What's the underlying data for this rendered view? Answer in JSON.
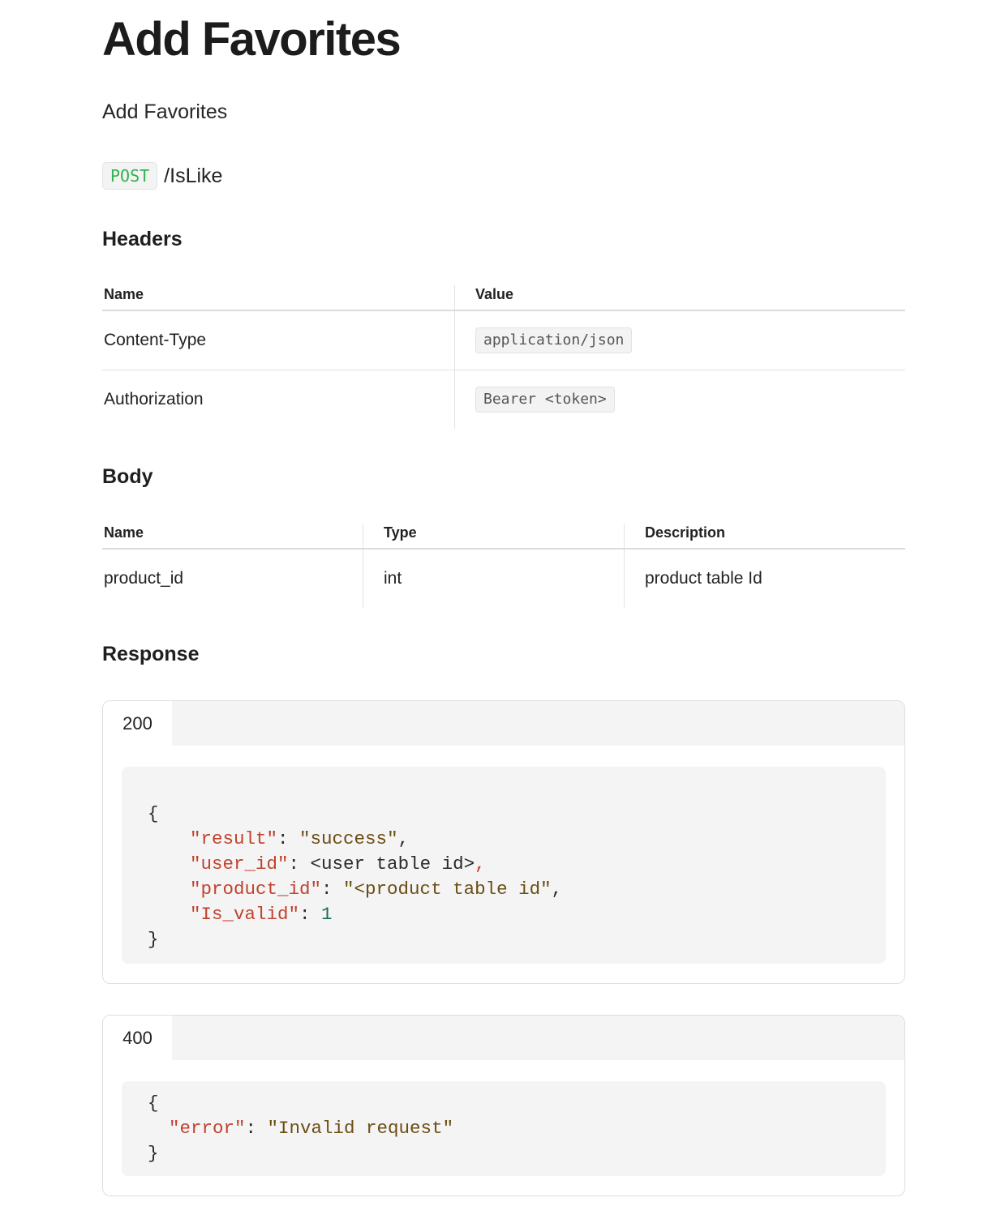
{
  "page": {
    "title": "Add Favorites",
    "description": "Add Favorites"
  },
  "endpoint": {
    "method": "POST",
    "path": "/IsLike",
    "method_color": "#2fb34f"
  },
  "headers": {
    "heading": "Headers",
    "columns": [
      "Name",
      "Value"
    ],
    "rows": [
      {
        "name": "Content-Type",
        "value": "application/json"
      },
      {
        "name": "Authorization",
        "value": "Bearer <token>"
      }
    ]
  },
  "body": {
    "heading": "Body",
    "columns": [
      "Name",
      "Type",
      "Description"
    ],
    "rows": [
      {
        "name": "product_id",
        "type": "int",
        "description": "product table Id"
      }
    ]
  },
  "response": {
    "heading": "Response",
    "blocks": [
      {
        "status": "200",
        "code": {
          "open": "{",
          "close": "}",
          "lines": [
            {
              "key": "\"result\"",
              "colon": ": ",
              "value": "\"success\"",
              "trail": ","
            },
            {
              "key": "\"user_id\"",
              "colon": ": ",
              "value": "<user table id>",
              "trail": ","
            },
            {
              "key": "\"product_id\"",
              "colon": ": ",
              "value": "\"<product table id\"",
              "trail": ","
            },
            {
              "key": "\"Is_valid\"",
              "colon": ": ",
              "value": "1",
              "trail": ""
            }
          ]
        }
      },
      {
        "status": "400",
        "code": {
          "open": "{",
          "close": "}",
          "lines": [
            {
              "key": "\"error\"",
              "colon": ": ",
              "value": "\"Invalid request\"",
              "trail": ""
            }
          ]
        }
      }
    ]
  },
  "colors": {
    "json_key": "#c2412d",
    "json_string": "#6a4d12",
    "json_number": "#1d6a5a"
  }
}
